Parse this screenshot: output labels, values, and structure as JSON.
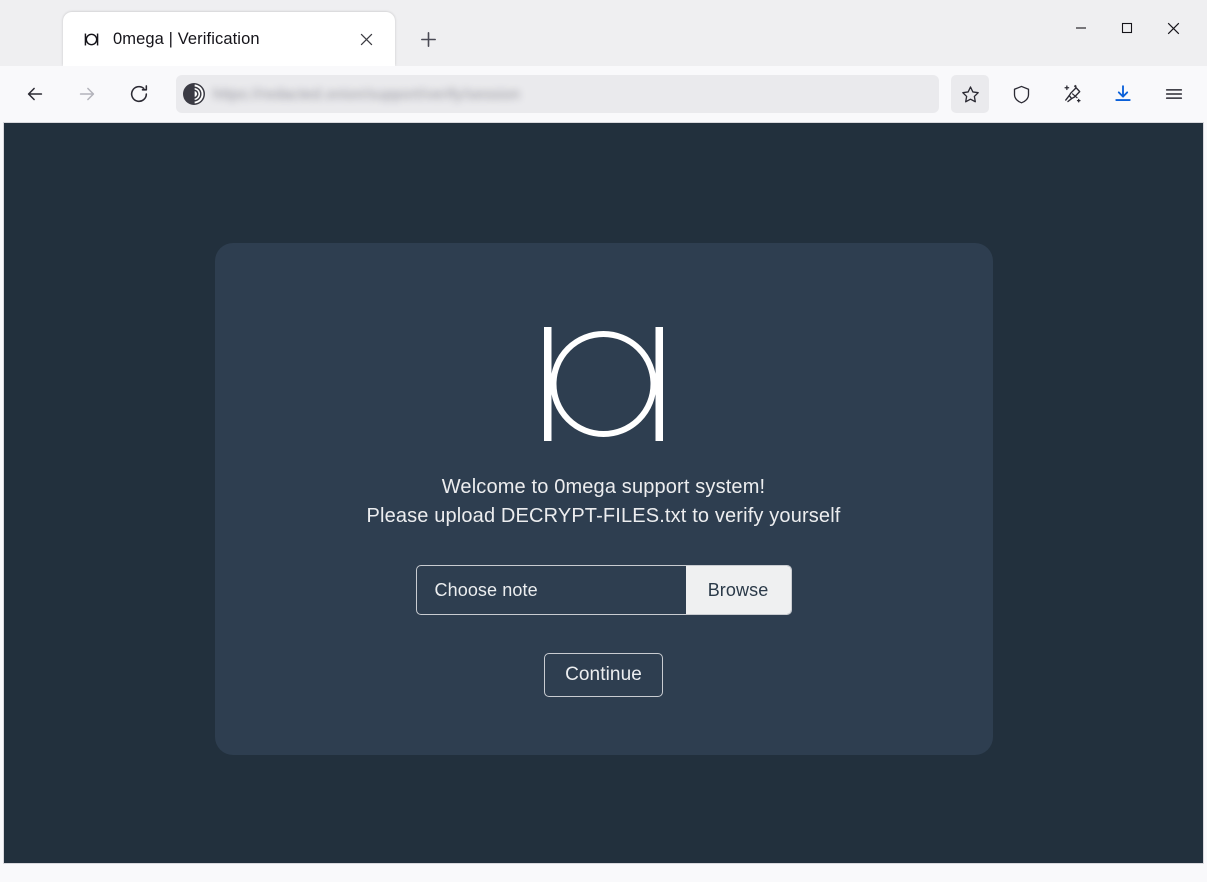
{
  "browser": {
    "tab": {
      "title": "0mega | Verification",
      "favicon_icon": "omega-logo-icon",
      "close_icon": "close-icon"
    },
    "new_tab_icon": "plus-icon",
    "window_controls": {
      "minimize_icon": "minimize-icon",
      "maximize_icon": "maximize-icon",
      "close_icon": "window-close-icon"
    },
    "nav": {
      "back_icon": "back-arrow-icon",
      "forward_icon": "forward-arrow-icon",
      "reload_icon": "reload-icon"
    },
    "urlbar": {
      "site_icon": "onion-circuit-icon",
      "url_text": "https://redacted.onion/support/verify/session",
      "url_state": "blurred"
    },
    "toolbar": {
      "bookmark_icon": "star-icon",
      "shield_icon": "shield-icon",
      "new_identity_icon": "broom-sparkle-icon",
      "downloads_icon": "download-arrow-icon",
      "menu_icon": "hamburger-menu-icon"
    }
  },
  "page": {
    "logo_icon": "omega-logo-icon",
    "headline_line1": "Welcome to 0mega support system!",
    "headline_line2": "Please upload DECRYPT-FILES.txt to verify yourself",
    "file_input": {
      "label": "Choose note",
      "browse_label": "Browse"
    },
    "continue_label": "Continue"
  },
  "colors": {
    "page_background": "#22303d",
    "card_background": "#2e3e50",
    "text_light": "#eceef0",
    "browse_button": "#eff0f1",
    "download_accent": "#0a60d9",
    "chrome_background": "#f9f9fb",
    "tabstrip_background": "#efeff1"
  }
}
